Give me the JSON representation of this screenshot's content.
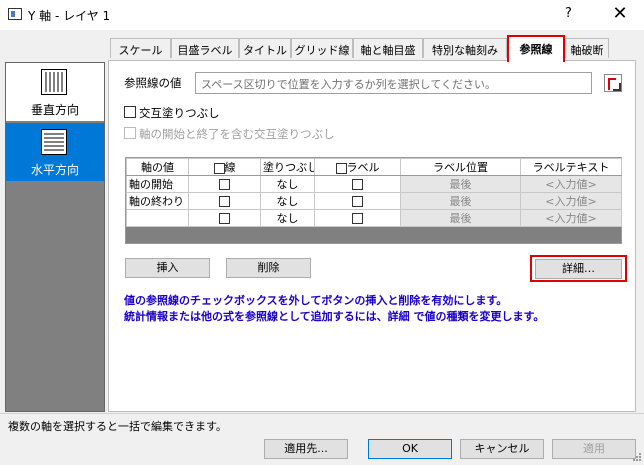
{
  "window": {
    "title": "Y 軸 - レイヤ 1",
    "help": "?",
    "close": "✕"
  },
  "nav": {
    "vertical": "垂直方向",
    "horizontal": "水平方向"
  },
  "tabs": [
    "スケール",
    "目盛ラベル",
    "タイトル",
    "グリッド線",
    "軸と軸目盛",
    "特別な軸刻み",
    "参照線",
    "軸破断"
  ],
  "active_tab": "参照線",
  "refline": {
    "value_label": "参照線の値",
    "placeholder": "スペース区切りで位置を入力するか列を選択してください。",
    "alternate_fill": "交互塗りつぶし",
    "alternate_fill_inclusive": "軸の開始と終了を含む交互塗りつぶし"
  },
  "table": {
    "headers": [
      "軸の値",
      "線",
      "塗りつぶし",
      "ラベル",
      "ラベル位置",
      "ラベルテキスト"
    ],
    "rows": [
      {
        "name": "軸の開始",
        "fill": "なし",
        "pos": "最後",
        "text": "<入力値>"
      },
      {
        "name": "軸の終わり",
        "fill": "なし",
        "pos": "最後",
        "text": "<入力値>"
      },
      {
        "name": "",
        "fill": "なし",
        "pos": "最後",
        "text": "<入力値>"
      }
    ]
  },
  "buttons": {
    "insert": "挿入",
    "delete": "削除",
    "details": "詳細…",
    "apply_to": "適用先...",
    "ok": "OK",
    "cancel": "キャンセル",
    "apply": "適用"
  },
  "notes": [
    "値の参照線のチェックボックスを外してボタンの挿入と削除を有効にします。",
    "統計情報または他の式を参照線として追加するには、詳細 で値の種類を変更します。"
  ],
  "status": "複数の軸を選択すると一括で編集できます。",
  "colors": {
    "accent": "#0078d7",
    "highlight_border": "#e00000",
    "note_text": "#1a00c8"
  }
}
